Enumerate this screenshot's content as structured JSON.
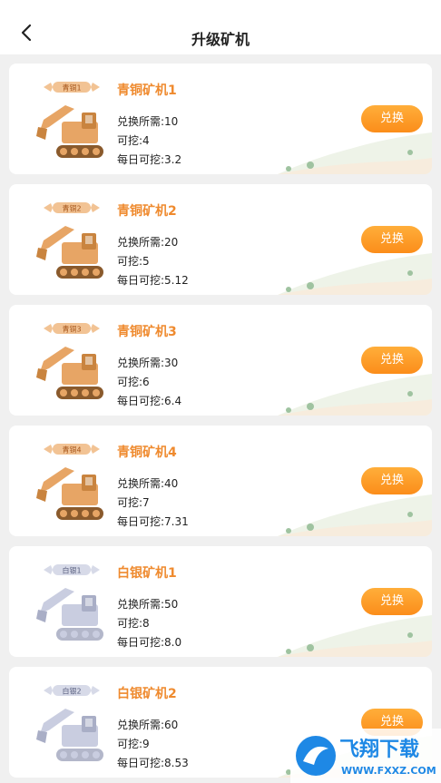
{
  "header": {
    "title": "升级矿机"
  },
  "cards": [
    {
      "badge": "青铜1",
      "name": "青铜矿机1",
      "cost": "兑换所需:10",
      "dig": "可挖:4",
      "daily": "每日可挖:3.2",
      "button": "兑换",
      "tier": "bronze"
    },
    {
      "badge": "青铜2",
      "name": "青铜矿机2",
      "cost": "兑换所需:20",
      "dig": "可挖:5",
      "daily": "每日可挖:5.12",
      "button": "兑换",
      "tier": "bronze"
    },
    {
      "badge": "青铜3",
      "name": "青铜矿机3",
      "cost": "兑换所需:30",
      "dig": "可挖:6",
      "daily": "每日可挖:6.4",
      "button": "兑换",
      "tier": "bronze"
    },
    {
      "badge": "青铜4",
      "name": "青铜矿机4",
      "cost": "兑换所需:40",
      "dig": "可挖:7",
      "daily": "每日可挖:7.31",
      "button": "兑换",
      "tier": "bronze"
    },
    {
      "badge": "白银1",
      "name": "白银矿机1",
      "cost": "兑换所需:50",
      "dig": "可挖:8",
      "daily": "每日可挖:8.0",
      "button": "兑换",
      "tier": "silver"
    },
    {
      "badge": "白银2",
      "name": "白银矿机2",
      "cost": "兑换所需:60",
      "dig": "可挖:9",
      "daily": "每日可挖:8.53",
      "button": "兑换",
      "tier": "silver"
    }
  ],
  "watermark": {
    "text": "飞翔下载",
    "url": "WWW.FXXZ.COM"
  },
  "colors": {
    "accent": "#ef8a2e",
    "button": "#fb9a2a",
    "bronze": "#e8a868",
    "silver": "#c4c8dc"
  }
}
